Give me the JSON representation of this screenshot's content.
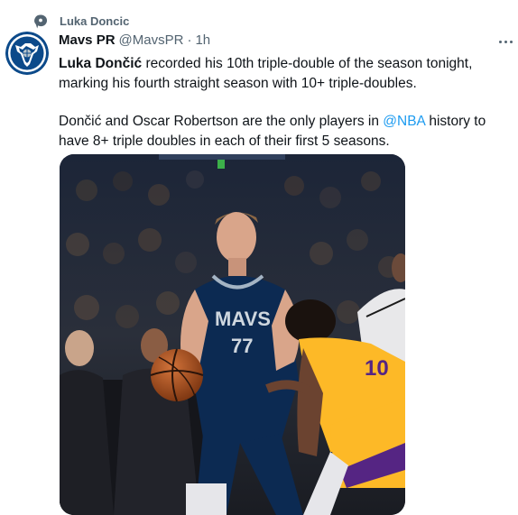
{
  "context": {
    "icon": "speech-bubble-icon",
    "label": "Luka Doncic"
  },
  "author": {
    "name": "Mavs PR",
    "handle": "@MavsPR",
    "separator": "·",
    "time": "1h",
    "avatar_icon": "mavericks-logo-icon"
  },
  "tweet": {
    "para1_bold": "Luka Dončić",
    "para1_rest": " recorded his 10th triple-double of the season tonight, marking his fourth straight season with 10+ triple-doubles.",
    "para2_before": "Dončić and Oscar Robertson are the only players in ",
    "para2_mention": "@NBA",
    "para2_after": " history to have 8+ triple doubles in each of their first 5 seasons."
  },
  "media": {
    "description_icon": "basketball-photo",
    "jersey_text": "MAVS",
    "jersey_number": "77",
    "opponent_number": "10"
  },
  "colors": {
    "mention": "#1d9bf0",
    "secondary": "#536471",
    "mavs_blue": "#0c4a8a",
    "lakers_gold": "#fdb927",
    "lakers_purple": "#552583"
  }
}
